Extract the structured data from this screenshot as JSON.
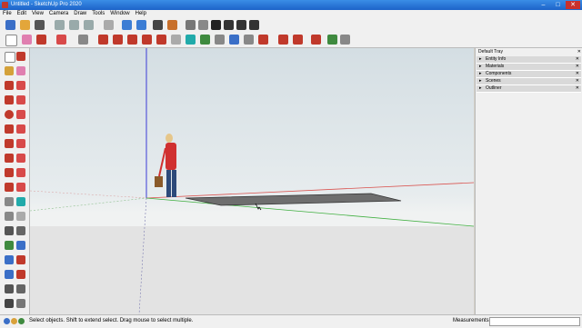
{
  "window": {
    "title": "Untitled - SketchUp Pro 2020",
    "min": "–",
    "max": "□",
    "close": "✕"
  },
  "menu": [
    "File",
    "Edit",
    "View",
    "Camera",
    "Draw",
    "Tools",
    "Window",
    "Help"
  ],
  "tray": {
    "title": "Default Tray",
    "sections": [
      "Entity Info",
      "Materials",
      "Components",
      "Scenes",
      "Outliner"
    ],
    "expand_glyph": "▸",
    "close_glyph": "✕"
  },
  "status": {
    "hint": "Select objects. Shift to extend select. Drag mouse to select multiple.",
    "measurements_label": "Measurements"
  },
  "icons": {
    "toolbar1": [
      "new-icon",
      "open-icon",
      "save-icon",
      "cut-icon",
      "copy-icon",
      "paste-icon",
      "erase-icon",
      "undo-icon",
      "redo-icon",
      "print-icon",
      "model-info-icon",
      "iso-view-icon",
      "top-view-icon",
      "front-view-icon",
      "right-view-icon",
      "back-view-icon",
      "left-view-icon"
    ],
    "toolbar2": [
      "select-icon",
      "eraser-icon",
      "line-icon",
      "arc-icon",
      "rectangle-icon",
      "push-pull-icon",
      "move-icon",
      "rotate-icon",
      "scale-icon",
      "offset-icon",
      "tape-measure-icon",
      "text-icon",
      "paint-bucket-icon",
      "orbit-icon",
      "pan-icon",
      "zoom-icon",
      "zoom-extents-icon",
      "warehouse-icon",
      "extension-icon",
      "layout-icon",
      "ruby-icon",
      "extension-manager-icon"
    ]
  },
  "colors": {
    "accent_red": "#d03030",
    "axis_blue": "#3b3bd6",
    "axis_red": "#d9534f",
    "axis_green": "#3faf3f",
    "shape_fill": "#6e6e6e"
  }
}
